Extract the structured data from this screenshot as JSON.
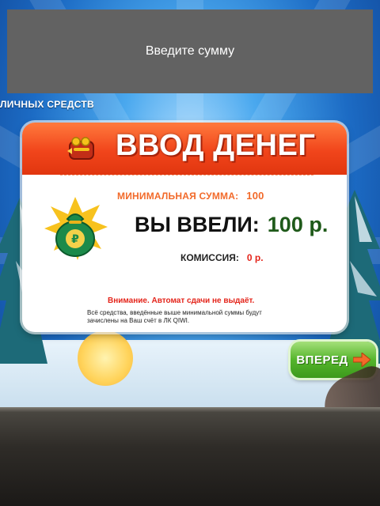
{
  "top_bar": {
    "text": "Введите сумму"
  },
  "background": {
    "edge_text": "ЛИЧНЫХ СРЕДСТВ"
  },
  "card": {
    "title": "ВВОД ДЕНЕГ",
    "min_label": "МИНИМАЛЬНАЯ СУММА:",
    "min_value": "100",
    "entered_label": "ВЫ ВВЕЛИ:",
    "entered_value": "100 р.",
    "fee_label": "КОМИССИЯ:",
    "fee_value": "0 р.",
    "warning": "Внимание. Автомат сдачи не выдаёт.",
    "note": "Всё средства, введённые выше минимальной суммы будут зачислены на Ваш счёт в ЛК QIWI."
  },
  "next_button": {
    "label": "ВПЕРЕД"
  },
  "icons": {
    "wallet": "wallet-icon",
    "money_bag": "money-bag-icon",
    "arrow": "arrow-right-icon"
  },
  "colors": {
    "header_orange": "#f1451b",
    "accent_orange": "#f26a2a",
    "accent_red": "#e4251b",
    "amount_green": "#1f5a1a",
    "button_green": "#55b52c",
    "top_bar_gray": "#626262"
  }
}
